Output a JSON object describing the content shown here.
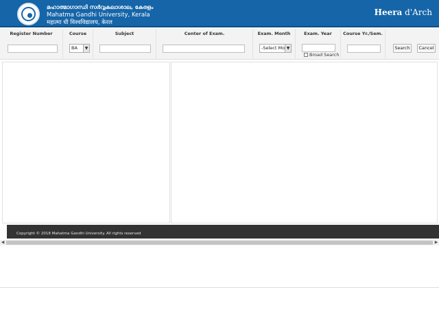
{
  "header": {
    "title_ml": "മഹാത്മാഗാന്ധി സർവ്വകലാശാല, കേരളം",
    "title_en": "Mahatma Gandhi University, Kerala",
    "title_hi": "महात्मा  धी  विश्वविद्यालय, केरल",
    "brand_bold": "Heera",
    "brand_rest": " d'Arch",
    "bg_color": "#1565a8"
  },
  "search": {
    "columns": {
      "register": "Register Number",
      "course": "Course",
      "subject": "Subject",
      "center": "Center of Exam.",
      "month": "Exam. Month",
      "year": "Exam. Year",
      "course_sem": "Course Yr./Sem."
    },
    "values": {
      "register": "",
      "course": "BA",
      "subject": "",
      "center": "",
      "month": "-Select Mon",
      "year": "",
      "course_sem": ""
    },
    "broad_search_label": "Broad Search",
    "broad_search_checked": false,
    "search_button": "Search",
    "cancel_button": "Cancel"
  },
  "footer": {
    "copyright": "Copyright © 2018 Mahatma Gandhi University. All rights reserved"
  },
  "scrollbar": {
    "left_arrow_icon": "chevron-left-icon",
    "right_arrow_icon": "chevron-right-icon"
  }
}
